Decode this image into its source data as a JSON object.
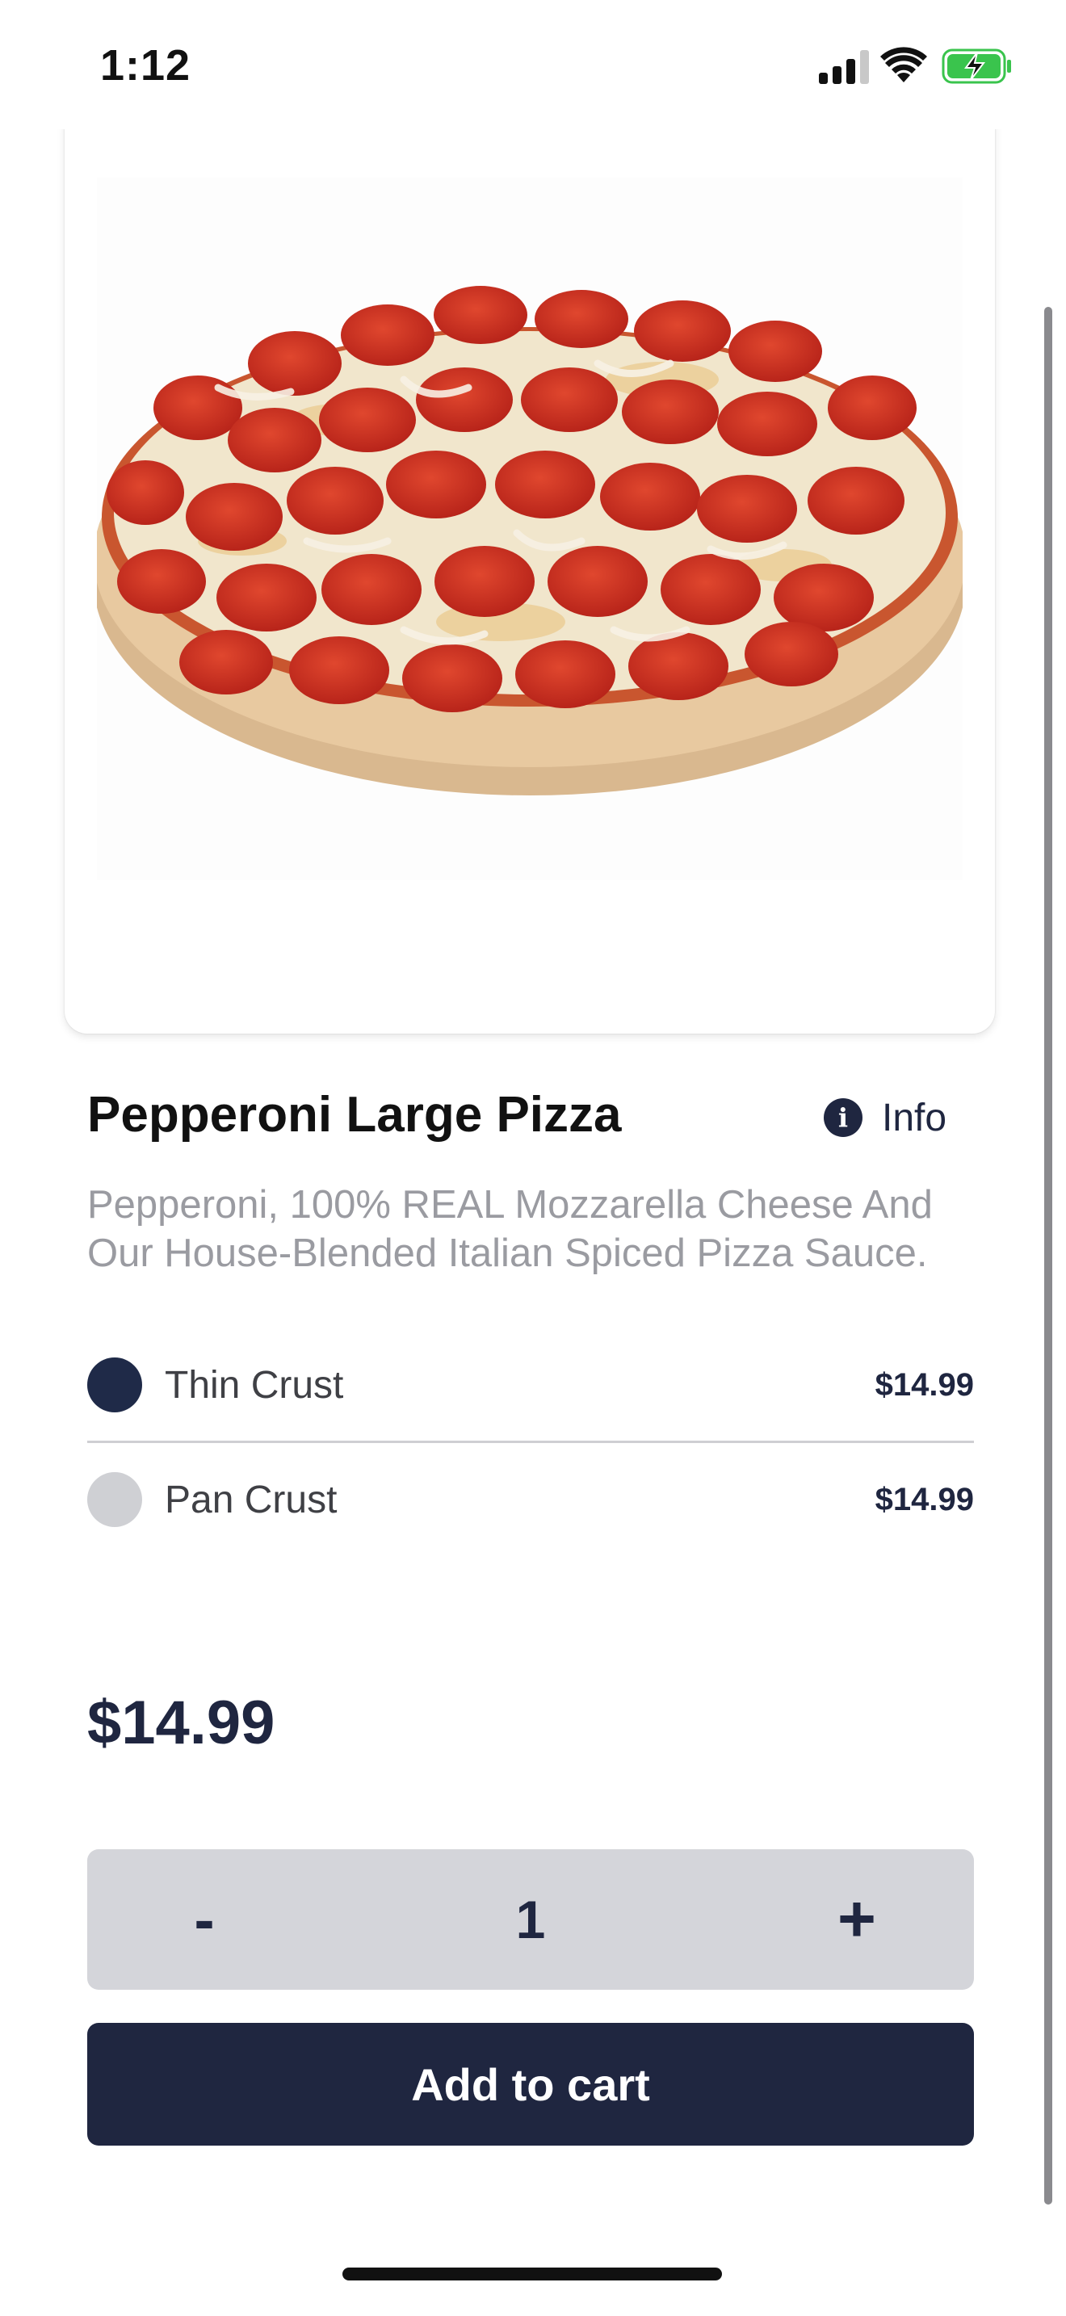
{
  "status_bar": {
    "time": "1:12",
    "icons": [
      "signal-icon",
      "wifi-icon",
      "battery-charging-icon"
    ]
  },
  "product": {
    "image_alt": "pizza-photo",
    "title": "Pepperoni Large Pizza",
    "info_label": "Info",
    "description": "Pepperoni, 100% REAL Mozzarella Cheese And Our House-Blended Italian Spiced Pizza Sauce."
  },
  "options": [
    {
      "name": "Thin Crust",
      "price": "$14.99",
      "selected": true
    },
    {
      "name": "Pan Crust",
      "price": "$14.99",
      "selected": false
    }
  ],
  "total_price": "$14.99",
  "quantity": {
    "minus_label": "-",
    "value": "1",
    "plus_label": "+"
  },
  "add_to_cart_label": "Add to cart",
  "colors": {
    "primary": "#1f2640",
    "unselected": "#cfd0d4",
    "stepper_bg": "#d4d5da",
    "description_text": "#9a9ba1",
    "battery": "#3ac44d"
  }
}
